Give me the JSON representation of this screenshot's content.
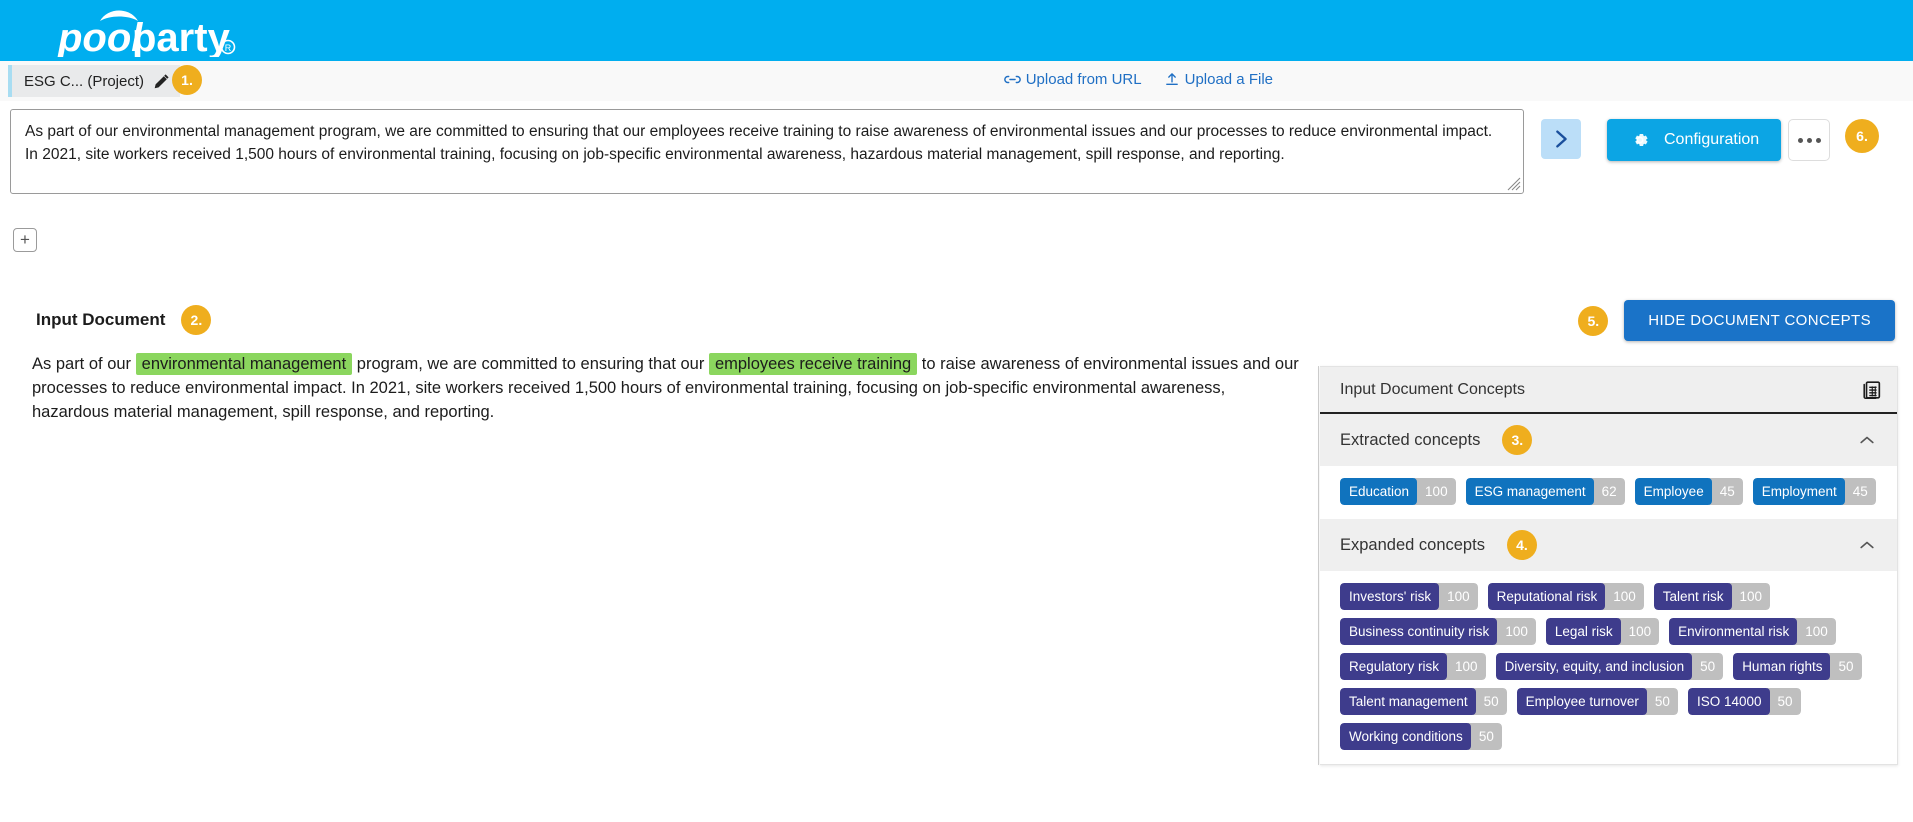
{
  "brand": {
    "name": "poolparty",
    "registered": "®"
  },
  "tabs": {
    "project_tab": {
      "label": "ESG C... (Project)",
      "edit_icon": "pencil-icon",
      "badge": "1."
    },
    "add_tab_label": "+"
  },
  "uploads": [
    {
      "label": "Upload from URL",
      "icon": "link-icon"
    },
    {
      "label": "Upload a File",
      "icon": "upload-icon"
    }
  ],
  "editor": {
    "text": "As part of our environmental management program, we are committed to ensuring that our employees receive training to raise awareness of environmental issues and our processes to reduce environmental impact. In 2021, site workers received 1,500 hours of environmental training, focusing on job-specific environmental awareness, hazardous material management, spill response, and reporting."
  },
  "toolbar": {
    "next_icon": "chevron-right-icon",
    "configuration_label": "Configuration",
    "configuration_icon": "gear-icon",
    "more_icon": "ellipsis-icon",
    "more_badge": "6."
  },
  "document": {
    "heading": "Input Document",
    "heading_badge": "2.",
    "segments": [
      {
        "text": "As part of our ",
        "highlight": false
      },
      {
        "text": "environmental management",
        "highlight": true
      },
      {
        "text": " program, we are committed to ensuring that our ",
        "highlight": false
      },
      {
        "text": "employees receive training",
        "highlight": true
      },
      {
        "text": " to raise awareness of environmental issues and our processes to reduce environmental impact. In 2021, site workers received 1,500 hours of environmental training, focusing on job-specific environmental awareness, hazardous material management, spill response, and reporting.",
        "highlight": false
      }
    ]
  },
  "hide_concepts": {
    "badge": "5.",
    "label": "HIDE DOCUMENT CONCEPTS"
  },
  "concepts_panel": {
    "title": "Input Document Concepts",
    "title_icon": "table-grid-icon",
    "sections": [
      {
        "label": "Extracted concepts",
        "badge": "3.",
        "collapse_icon": "chevron-up-icon",
        "chip_style": "blue",
        "chips": [
          {
            "name": "Education",
            "score": "100"
          },
          {
            "name": "ESG management",
            "score": "62"
          },
          {
            "name": "Employee",
            "score": "45"
          },
          {
            "name": "Employment",
            "score": "45"
          }
        ]
      },
      {
        "label": "Expanded concepts",
        "badge": "4.",
        "collapse_icon": "chevron-up-icon",
        "chip_style": "purple",
        "chips": [
          {
            "name": "Investors' risk",
            "score": "100"
          },
          {
            "name": "Reputational risk",
            "score": "100"
          },
          {
            "name": "Talent risk",
            "score": "100"
          },
          {
            "name": "Business continuity risk",
            "score": "100"
          },
          {
            "name": "Legal risk",
            "score": "100"
          },
          {
            "name": "Environmental risk",
            "score": "100"
          },
          {
            "name": "Regulatory risk",
            "score": "100"
          },
          {
            "name": "Diversity, equity, and inclusion",
            "score": "50"
          },
          {
            "name": "Human rights",
            "score": "50"
          },
          {
            "name": "Talent management",
            "score": "50"
          },
          {
            "name": "Employee turnover",
            "score": "50"
          },
          {
            "name": "ISO 14000",
            "score": "50"
          },
          {
            "name": "Working conditions",
            "score": "50"
          }
        ]
      }
    ]
  },
  "colors": {
    "brand_blue": "#00AEEF",
    "badge_orange": "#EFAE1E",
    "highlight_green": "#8BD65E",
    "chip_blue": "#1073BE",
    "chip_purple": "#3E3C8C",
    "chip_score_gray": "#BFBFBF",
    "button_blue": "#1A73C8",
    "config_cyan": "#0CA5E4"
  }
}
